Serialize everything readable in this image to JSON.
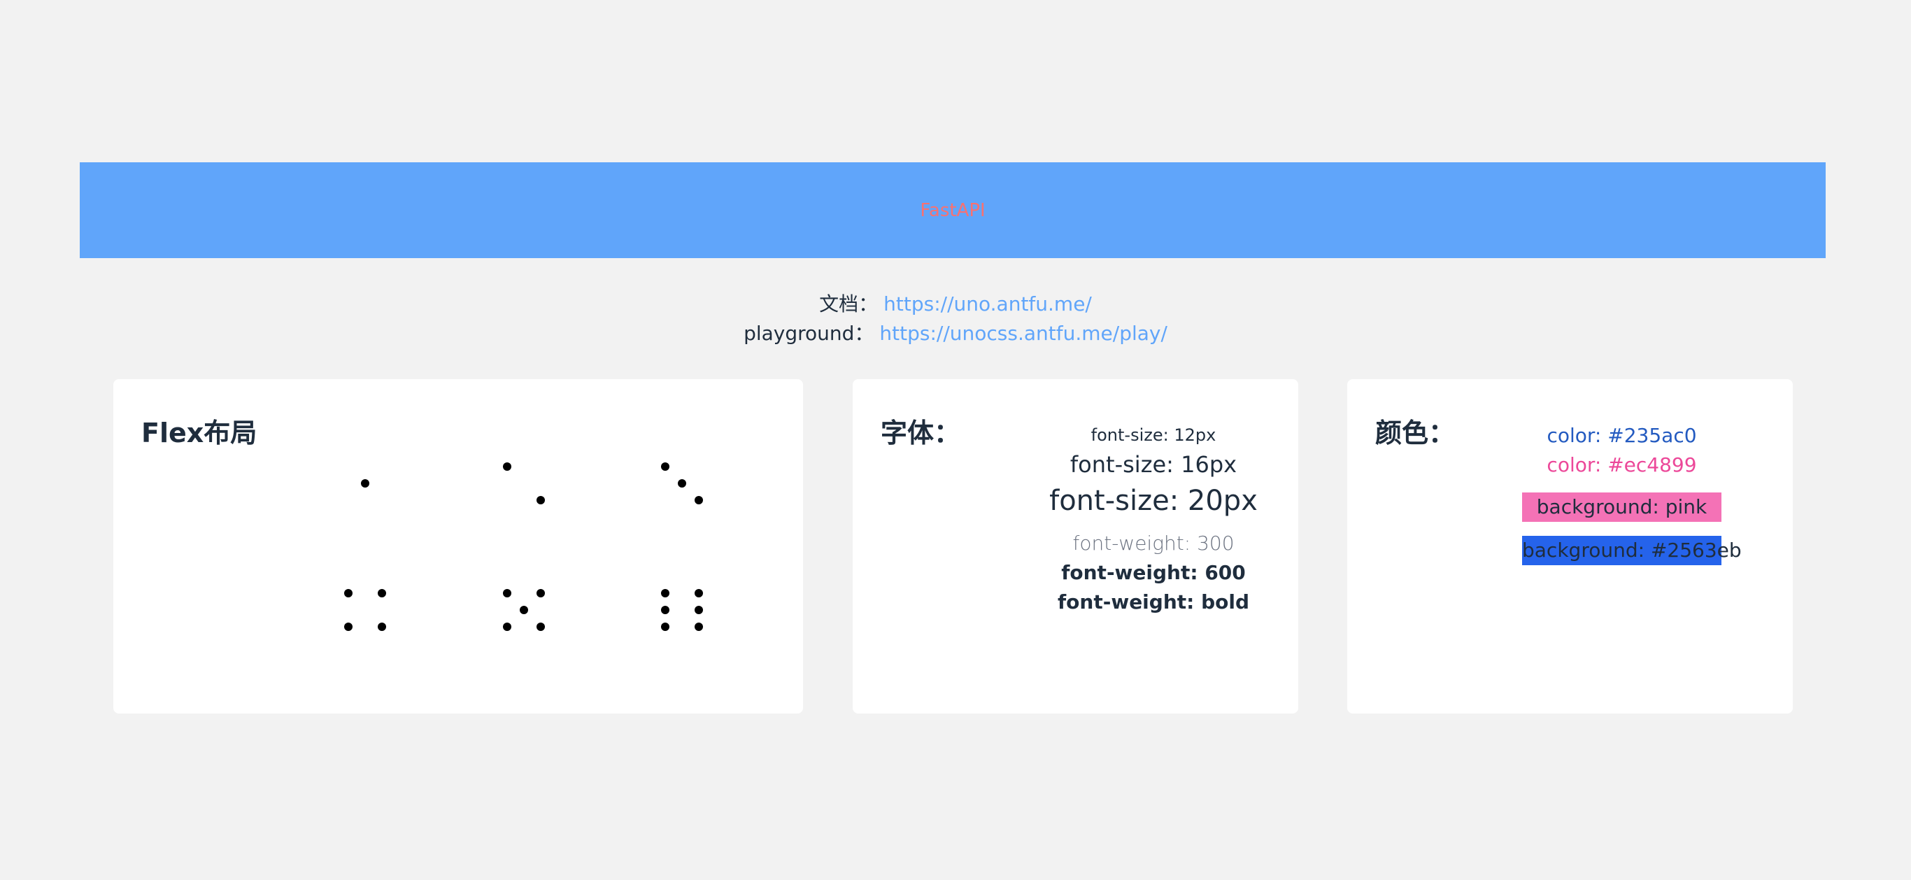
{
  "banner": {
    "title": "FastAPI"
  },
  "links": {
    "docs_label": "文档：",
    "docs_url": "https://uno.antfu.me/",
    "playground_label": "playground：",
    "playground_url": "https://unocss.antfu.me/play/"
  },
  "flex_card": {
    "title": "Flex布局",
    "dice_faces": [
      1,
      2,
      3,
      4,
      5,
      6
    ]
  },
  "font_card": {
    "title": "字体：",
    "items": [
      "font-size: 12px",
      "font-size: 16px",
      "font-size: 20px",
      "font-weight: 300",
      "font-weight: 600",
      "font-weight: bold"
    ]
  },
  "color_card": {
    "title": "颜色：",
    "color1": "color: #235ac0",
    "color2": "color: #ec4899",
    "bg1": "background: pink",
    "bg2": "background: #2563eb",
    "colors": {
      "banner": "#60a5fa",
      "banner_text": "#f87171",
      "link": "#60a5fa",
      "blue_text": "#235ac0",
      "pink_text": "#ec4899",
      "pink_bg": "#f472b6",
      "blue_bg": "#2563eb"
    }
  }
}
